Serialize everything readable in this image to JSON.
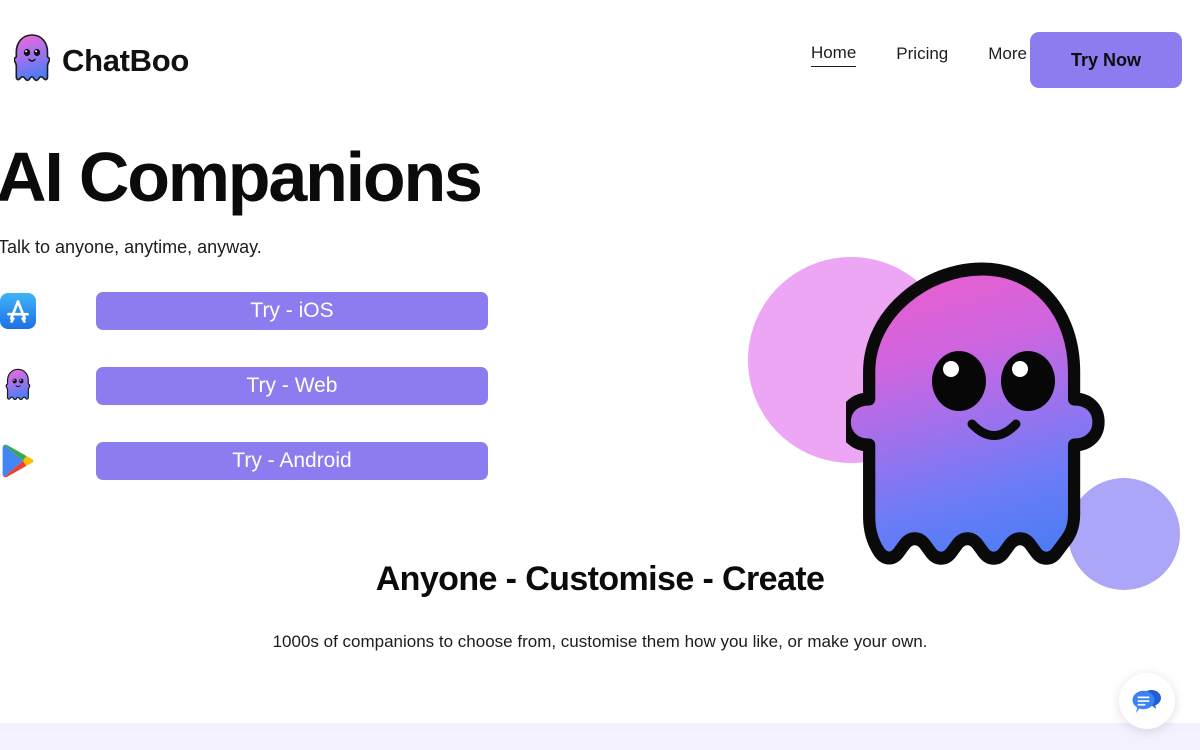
{
  "brand": {
    "name": "ChatBoo",
    "logo_icon": "ghost-logo-icon"
  },
  "nav": {
    "links": [
      {
        "label": "Home",
        "active": true
      },
      {
        "label": "Pricing",
        "active": false
      },
      {
        "label": "More",
        "active": false,
        "icon": "chevron-down-icon"
      }
    ],
    "cta_label": "Try Now"
  },
  "hero": {
    "title": "AI Companions",
    "subtitle": "Talk to anyone, anytime, anyway.",
    "ctas": [
      {
        "label": "Try - iOS",
        "icon": "app-store-icon"
      },
      {
        "label": "Try - Web",
        "icon": "ghost-logo-icon"
      },
      {
        "label": "Try - Android",
        "icon": "google-play-icon"
      }
    ],
    "mascot_icon": "ghost-mascot-icon"
  },
  "features": {
    "title": "Anyone - Customise - Create",
    "subtitle": "1000s of companions to choose from, customise them how you like, or make your own."
  },
  "chat_widget": {
    "icon": "chat-bubbles-icon"
  },
  "colors": {
    "accent_purple": "#8b7cf0",
    "blob_pink": "#eda6f4",
    "blob_periwinkle": "#aba6f7",
    "footer_strip": "#f2f1fd",
    "ghost_gradient_top": "#e45fd0",
    "ghost_gradient_bottom": "#4f7cf5",
    "chat_blue": "#2f74e8"
  }
}
